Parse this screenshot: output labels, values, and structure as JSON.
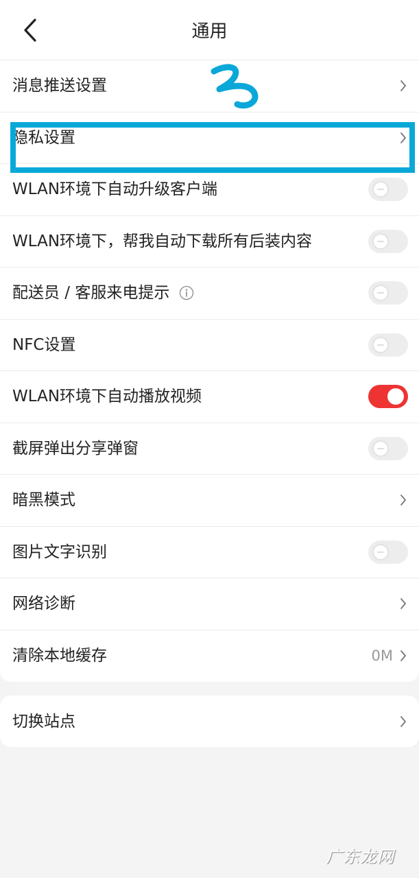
{
  "header": {
    "title": "通用"
  },
  "main_rows": [
    {
      "label": "消息推送设置",
      "type": "chevron"
    },
    {
      "label": "隐私设置",
      "type": "chevron"
    },
    {
      "label": "WLAN环境下自动升级客户端",
      "type": "toggle",
      "on": false
    },
    {
      "label": "WLAN环境下，帮我自动下载所有后装内容",
      "type": "toggle",
      "on": false
    },
    {
      "label": "配送员 / 客服来电提示",
      "type": "toggle",
      "on": false,
      "info": true
    },
    {
      "label": "NFC设置",
      "type": "toggle",
      "on": false
    },
    {
      "label": "WLAN环境下自动播放视频",
      "type": "toggle",
      "on": true
    },
    {
      "label": "截屏弹出分享弹窗",
      "type": "toggle",
      "on": false
    },
    {
      "label": "暗黑模式",
      "type": "chevron"
    },
    {
      "label": "图片文字识别",
      "type": "toggle",
      "on": false
    },
    {
      "label": "网络诊断",
      "type": "chevron"
    },
    {
      "label": "清除本地缓存",
      "type": "chevron",
      "value": "0M"
    }
  ],
  "second_rows": [
    {
      "label": "切换站点",
      "type": "chevron"
    }
  ],
  "annotation": {
    "scribble_text": "3",
    "color": "#0aa8d8"
  },
  "watermark": "广东龙网",
  "colors": {
    "toggle_on": "#ee3333",
    "toggle_off": "#ededed",
    "background": "#f4f4f4"
  }
}
